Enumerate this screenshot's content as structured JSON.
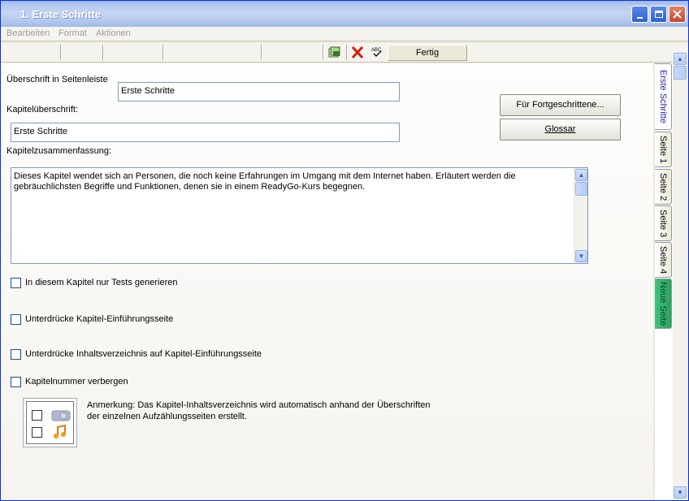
{
  "window": {
    "title": "1. Erste Schritte"
  },
  "menu": {
    "items": [
      "Bearbeiten",
      "Format",
      "Aktionen"
    ]
  },
  "toolbar": {
    "done_label": "Fertig",
    "icons": [
      "page-icon",
      "delete-icon",
      "spellcheck-icon"
    ]
  },
  "form": {
    "sidebar_heading_label": "Überschrift in Seitenleiste",
    "sidebar_heading_value": "Erste Schritte",
    "chapter_heading_label": "Kapitelüberschrift:",
    "chapter_heading_value": "Erste Schritte",
    "summary_label": "Kapitelzusammenfassung:",
    "summary_value": "Dieses Kapitel wendet sich an Personen, die noch keine Erfahrungen im Umgang mit dem Internet haben. Erläutert werden die gebräuchlichsten Begriffe und Funktionen, denen sie in einem ReadyGo-Kurs begegnen."
  },
  "buttons": {
    "advanced": "Für Fortgeschrittene...",
    "glossary": "Glossar"
  },
  "checkboxes": [
    {
      "label": "In diesem Kapitel nur Tests generieren",
      "checked": false
    },
    {
      "label": "Unterdrücke Kapitel-Einführungsseite",
      "checked": false
    },
    {
      "label": "Unterdrücke Inhaltsverzeichnis auf Kapitel-Einführungsseite",
      "checked": false
    },
    {
      "label": "Kapitelnummer verbergen",
      "checked": false
    }
  ],
  "note": "Anmerkung: Das Kapitel-Inhaltsverzeichnis wird automatisch anhand der Überschriften der einzelnen Aufzählungsseiten erstellt.",
  "tabs": [
    {
      "label": "Erste Schritte",
      "active": true
    },
    {
      "label": "Seite 1"
    },
    {
      "label": "Seite 2"
    },
    {
      "label": "Seite 3"
    },
    {
      "label": "Seite 4"
    },
    {
      "label": "Neue Seite",
      "accent": "#2ba460"
    }
  ]
}
